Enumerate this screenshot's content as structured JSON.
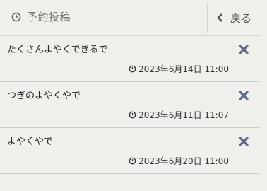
{
  "header": {
    "title": "予約投稿",
    "title_icon": "clock-icon",
    "back_label": "戻る",
    "back_icon": "chevron-left-icon"
  },
  "posts": [
    {
      "text": "たくさんよやくできるで",
      "scheduled": "2023年6月14日 11:00"
    },
    {
      "text": "つぎのよやくやで",
      "scheduled": "2023年6月11日 11:07"
    },
    {
      "text": "よやくやで",
      "scheduled": "2023年6月20日 11:00"
    }
  ],
  "colors": {
    "background": "#efefeb",
    "delete_icon": "#5b6a86",
    "divider": "#c9ccd3"
  }
}
